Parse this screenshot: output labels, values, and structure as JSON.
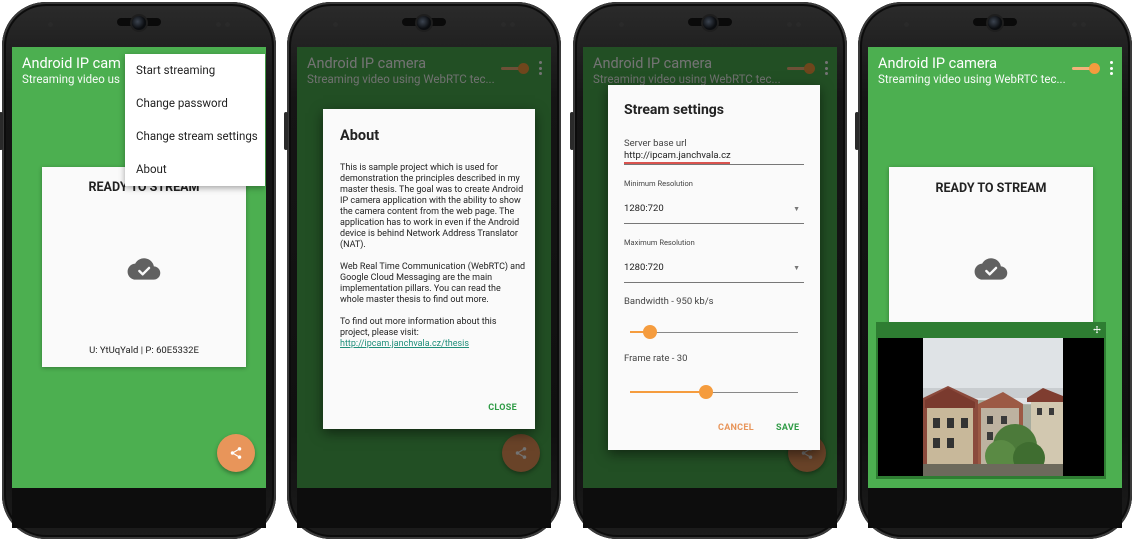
{
  "app": {
    "title": "Android IP camera",
    "subtitle": "Streaming video using WebRTC tec...",
    "title_truncated": "Android IP cam",
    "subtitle_truncated": "Streaming video us"
  },
  "status_card": {
    "title": "READY TO STREAM",
    "credentials": "U: YtUqYald | P: 60E5332E"
  },
  "overflow_menu": {
    "items": [
      "Start streaming",
      "Change password",
      "Change stream settings",
      "About"
    ]
  },
  "about_dialog": {
    "title": "About",
    "paragraph1": "This is sample project which is used for demonstration the principles described in my master thesis. The goal was to create Android IP camera application with the ability to show the camera content from the web page. The application has to work in even if the Android device is behind Network Address Translator (NAT).",
    "paragraph2": "Web Real Time Communication (WebRTC) and Google Cloud Messaging are the main implementation pillars. You can read the whole master thesis to find out more.",
    "paragraph3": "To find out more information about this project, please visit:",
    "link": "http://ipcam.janchvala.cz/thesis",
    "close_label": "CLOSE"
  },
  "stream_settings": {
    "title": "Stream settings",
    "server_label": "Server base url",
    "server_value": "http://ipcam.janchvala.cz",
    "min_res_label": "Minimum Resolution",
    "min_res_value": "1280:720",
    "max_res_label": "Maximum Resolution",
    "max_res_value": "1280:720",
    "bandwidth_label": "Bandwidth - 950 kb/s",
    "bandwidth_fraction": 0.12,
    "framerate_label": "Frame rate - 30",
    "framerate_fraction": 0.45,
    "cancel_label": "CANCEL",
    "save_label": "SAVE"
  },
  "colors": {
    "primary_green": "#4caf50",
    "dark_green": "#2e7d32",
    "accent_orange": "#f59c3e",
    "fab_orange": "#e8955a",
    "link_teal": "#1f8e7a",
    "save_green": "#2e9b45"
  },
  "icons": {
    "share": "share-icon",
    "cloud_check": "cloud-done-icon",
    "overflow": "more-vert-icon",
    "resize": "move-icon"
  }
}
